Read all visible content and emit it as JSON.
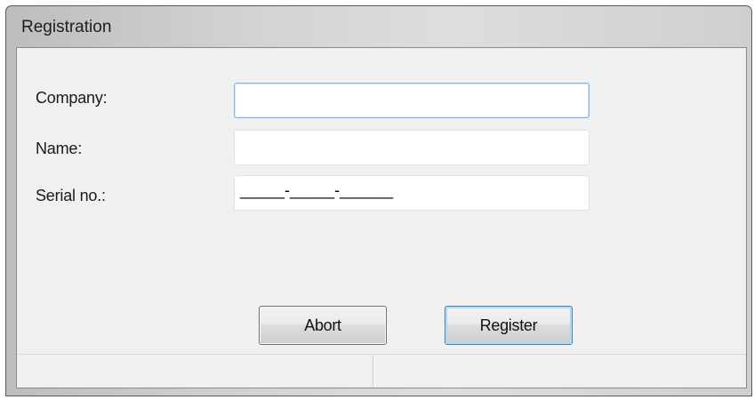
{
  "window": {
    "title": "Registration"
  },
  "form": {
    "company": {
      "label": "Company:",
      "value": "",
      "placeholder": ""
    },
    "name": {
      "label": "Name:",
      "value": "",
      "placeholder": ""
    },
    "serial": {
      "label": "Serial no.:",
      "mask": "_____-_____-______"
    }
  },
  "buttons": {
    "abort_label": "Abort",
    "register_label": "Register"
  },
  "status_bar": {
    "left_text": "",
    "right_text": ""
  },
  "colors": {
    "focus_border": "#7eb4ea",
    "default_button_border": "#3c7fb1",
    "client_background": "#f0f0f0"
  }
}
